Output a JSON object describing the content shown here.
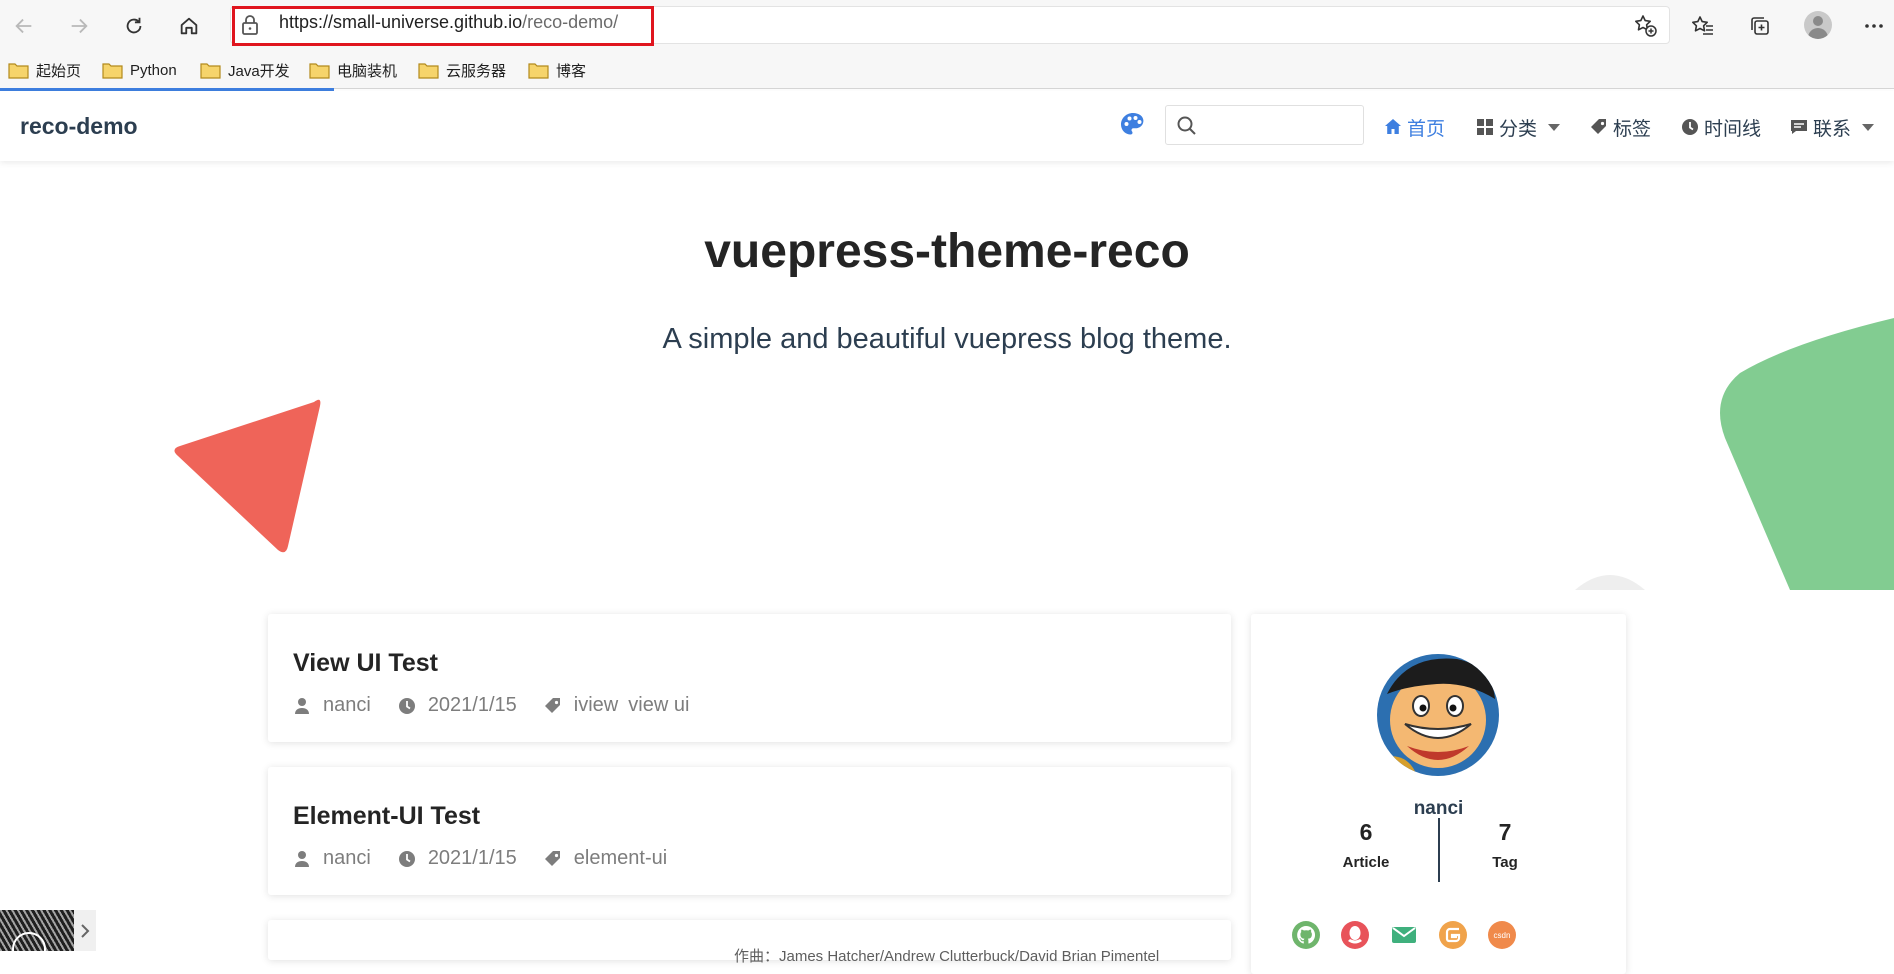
{
  "browser": {
    "url_host": "https://small-universe.github.io",
    "url_path": "/reco-demo/",
    "bookmarks": [
      "起始页",
      "Python",
      "Java开发",
      "电脑装机",
      "云服务器",
      "博客"
    ],
    "accent_color": "#e0151e"
  },
  "site": {
    "title": "reco-demo",
    "nav": {
      "home": "首页",
      "category": "分类",
      "tags": "标签",
      "timeline": "时间线",
      "contact": "联系"
    },
    "search_placeholder": "",
    "brand_color": "#3e7fe0"
  },
  "hero": {
    "title": "vuepress-theme-reco",
    "description": "A simple and beautiful vuepress blog theme."
  },
  "posts": [
    {
      "title": "View UI Test",
      "author": "nanci",
      "date": "2021/1/15",
      "tags": [
        "iview",
        "view ui"
      ]
    },
    {
      "title": "Element-UI Test",
      "author": "nanci",
      "date": "2021/1/15",
      "tags": [
        "element-ui"
      ]
    }
  ],
  "partial_text": "作曲：James Hatcher/Andrew Clutterbuck/David Brian Pimentel",
  "profile": {
    "name": "nanci",
    "article_count": "6",
    "article_label": "Article",
    "tag_count": "7",
    "tag_label": "Tag",
    "social_icons": [
      "github-icon",
      "qq-icon",
      "email-icon",
      "gitee-icon",
      "csdn-icon"
    ],
    "csdn_label": "csdn"
  }
}
